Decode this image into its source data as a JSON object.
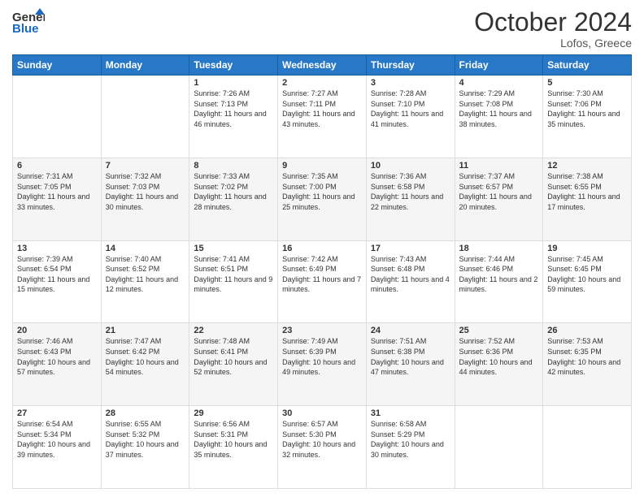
{
  "header": {
    "logo_line1": "General",
    "logo_line2": "Blue",
    "month": "October 2024",
    "location": "Lofos, Greece"
  },
  "days_of_week": [
    "Sunday",
    "Monday",
    "Tuesday",
    "Wednesday",
    "Thursday",
    "Friday",
    "Saturday"
  ],
  "weeks": [
    [
      {
        "day": "",
        "content": ""
      },
      {
        "day": "",
        "content": ""
      },
      {
        "day": "1",
        "sunrise": "Sunrise: 7:26 AM",
        "sunset": "Sunset: 7:13 PM",
        "daylight": "Daylight: 11 hours and 46 minutes."
      },
      {
        "day": "2",
        "sunrise": "Sunrise: 7:27 AM",
        "sunset": "Sunset: 7:11 PM",
        "daylight": "Daylight: 11 hours and 43 minutes."
      },
      {
        "day": "3",
        "sunrise": "Sunrise: 7:28 AM",
        "sunset": "Sunset: 7:10 PM",
        "daylight": "Daylight: 11 hours and 41 minutes."
      },
      {
        "day": "4",
        "sunrise": "Sunrise: 7:29 AM",
        "sunset": "Sunset: 7:08 PM",
        "daylight": "Daylight: 11 hours and 38 minutes."
      },
      {
        "day": "5",
        "sunrise": "Sunrise: 7:30 AM",
        "sunset": "Sunset: 7:06 PM",
        "daylight": "Daylight: 11 hours and 35 minutes."
      }
    ],
    [
      {
        "day": "6",
        "sunrise": "Sunrise: 7:31 AM",
        "sunset": "Sunset: 7:05 PM",
        "daylight": "Daylight: 11 hours and 33 minutes."
      },
      {
        "day": "7",
        "sunrise": "Sunrise: 7:32 AM",
        "sunset": "Sunset: 7:03 PM",
        "daylight": "Daylight: 11 hours and 30 minutes."
      },
      {
        "day": "8",
        "sunrise": "Sunrise: 7:33 AM",
        "sunset": "Sunset: 7:02 PM",
        "daylight": "Daylight: 11 hours and 28 minutes."
      },
      {
        "day": "9",
        "sunrise": "Sunrise: 7:35 AM",
        "sunset": "Sunset: 7:00 PM",
        "daylight": "Daylight: 11 hours and 25 minutes."
      },
      {
        "day": "10",
        "sunrise": "Sunrise: 7:36 AM",
        "sunset": "Sunset: 6:58 PM",
        "daylight": "Daylight: 11 hours and 22 minutes."
      },
      {
        "day": "11",
        "sunrise": "Sunrise: 7:37 AM",
        "sunset": "Sunset: 6:57 PM",
        "daylight": "Daylight: 11 hours and 20 minutes."
      },
      {
        "day": "12",
        "sunrise": "Sunrise: 7:38 AM",
        "sunset": "Sunset: 6:55 PM",
        "daylight": "Daylight: 11 hours and 17 minutes."
      }
    ],
    [
      {
        "day": "13",
        "sunrise": "Sunrise: 7:39 AM",
        "sunset": "Sunset: 6:54 PM",
        "daylight": "Daylight: 11 hours and 15 minutes."
      },
      {
        "day": "14",
        "sunrise": "Sunrise: 7:40 AM",
        "sunset": "Sunset: 6:52 PM",
        "daylight": "Daylight: 11 hours and 12 minutes."
      },
      {
        "day": "15",
        "sunrise": "Sunrise: 7:41 AM",
        "sunset": "Sunset: 6:51 PM",
        "daylight": "Daylight: 11 hours and 9 minutes."
      },
      {
        "day": "16",
        "sunrise": "Sunrise: 7:42 AM",
        "sunset": "Sunset: 6:49 PM",
        "daylight": "Daylight: 11 hours and 7 minutes."
      },
      {
        "day": "17",
        "sunrise": "Sunrise: 7:43 AM",
        "sunset": "Sunset: 6:48 PM",
        "daylight": "Daylight: 11 hours and 4 minutes."
      },
      {
        "day": "18",
        "sunrise": "Sunrise: 7:44 AM",
        "sunset": "Sunset: 6:46 PM",
        "daylight": "Daylight: 11 hours and 2 minutes."
      },
      {
        "day": "19",
        "sunrise": "Sunrise: 7:45 AM",
        "sunset": "Sunset: 6:45 PM",
        "daylight": "Daylight: 10 hours and 59 minutes."
      }
    ],
    [
      {
        "day": "20",
        "sunrise": "Sunrise: 7:46 AM",
        "sunset": "Sunset: 6:43 PM",
        "daylight": "Daylight: 10 hours and 57 minutes."
      },
      {
        "day": "21",
        "sunrise": "Sunrise: 7:47 AM",
        "sunset": "Sunset: 6:42 PM",
        "daylight": "Daylight: 10 hours and 54 minutes."
      },
      {
        "day": "22",
        "sunrise": "Sunrise: 7:48 AM",
        "sunset": "Sunset: 6:41 PM",
        "daylight": "Daylight: 10 hours and 52 minutes."
      },
      {
        "day": "23",
        "sunrise": "Sunrise: 7:49 AM",
        "sunset": "Sunset: 6:39 PM",
        "daylight": "Daylight: 10 hours and 49 minutes."
      },
      {
        "day": "24",
        "sunrise": "Sunrise: 7:51 AM",
        "sunset": "Sunset: 6:38 PM",
        "daylight": "Daylight: 10 hours and 47 minutes."
      },
      {
        "day": "25",
        "sunrise": "Sunrise: 7:52 AM",
        "sunset": "Sunset: 6:36 PM",
        "daylight": "Daylight: 10 hours and 44 minutes."
      },
      {
        "day": "26",
        "sunrise": "Sunrise: 7:53 AM",
        "sunset": "Sunset: 6:35 PM",
        "daylight": "Daylight: 10 hours and 42 minutes."
      }
    ],
    [
      {
        "day": "27",
        "sunrise": "Sunrise: 6:54 AM",
        "sunset": "Sunset: 5:34 PM",
        "daylight": "Daylight: 10 hours and 39 minutes."
      },
      {
        "day": "28",
        "sunrise": "Sunrise: 6:55 AM",
        "sunset": "Sunset: 5:32 PM",
        "daylight": "Daylight: 10 hours and 37 minutes."
      },
      {
        "day": "29",
        "sunrise": "Sunrise: 6:56 AM",
        "sunset": "Sunset: 5:31 PM",
        "daylight": "Daylight: 10 hours and 35 minutes."
      },
      {
        "day": "30",
        "sunrise": "Sunrise: 6:57 AM",
        "sunset": "Sunset: 5:30 PM",
        "daylight": "Daylight: 10 hours and 32 minutes."
      },
      {
        "day": "31",
        "sunrise": "Sunrise: 6:58 AM",
        "sunset": "Sunset: 5:29 PM",
        "daylight": "Daylight: 10 hours and 30 minutes."
      },
      {
        "day": "",
        "content": ""
      },
      {
        "day": "",
        "content": ""
      }
    ]
  ]
}
